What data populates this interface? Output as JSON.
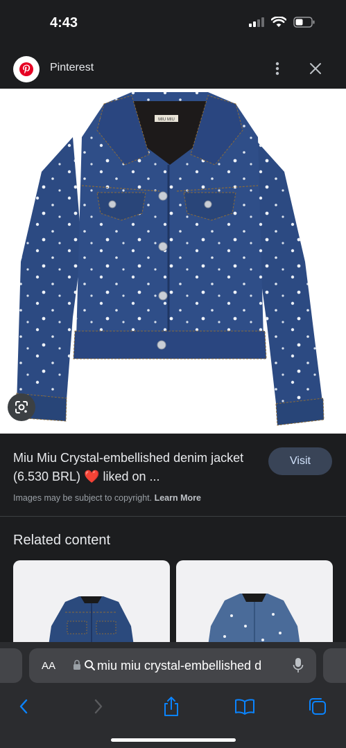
{
  "status_bar": {
    "time": "4:43"
  },
  "header": {
    "site_name": "Pinterest",
    "logo_icon": "pinterest-logo",
    "more_icon": "more-vertical-icon",
    "close_icon": "close-icon"
  },
  "result": {
    "title": "Miu Miu Crystal-embellished denim jacket (6.530 BRL) ❤️ liked on ...",
    "visit_label": "Visit",
    "copyright_text": "Images may be subject to copyright.",
    "learn_more_label": "Learn More",
    "lens_icon": "google-lens-icon",
    "collar_label_text": "MIU MIU"
  },
  "related": {
    "title": "Related content"
  },
  "address_bar": {
    "reader_label": "AA",
    "url_text": "miu miu crystal-embellished d",
    "lock_icon": "lock-icon",
    "search_icon": "search-icon",
    "mic_icon": "microphone-icon"
  },
  "toolbar": {
    "back_icon": "back-icon",
    "forward_icon": "forward-icon",
    "share_icon": "share-icon",
    "bookmarks_icon": "bookmarks-icon",
    "tabs_icon": "tabs-icon"
  },
  "colors": {
    "background": "#1c1d1f",
    "accent": "#0a84ff",
    "visit_button": "#394457",
    "denim": "#2c4a82"
  }
}
